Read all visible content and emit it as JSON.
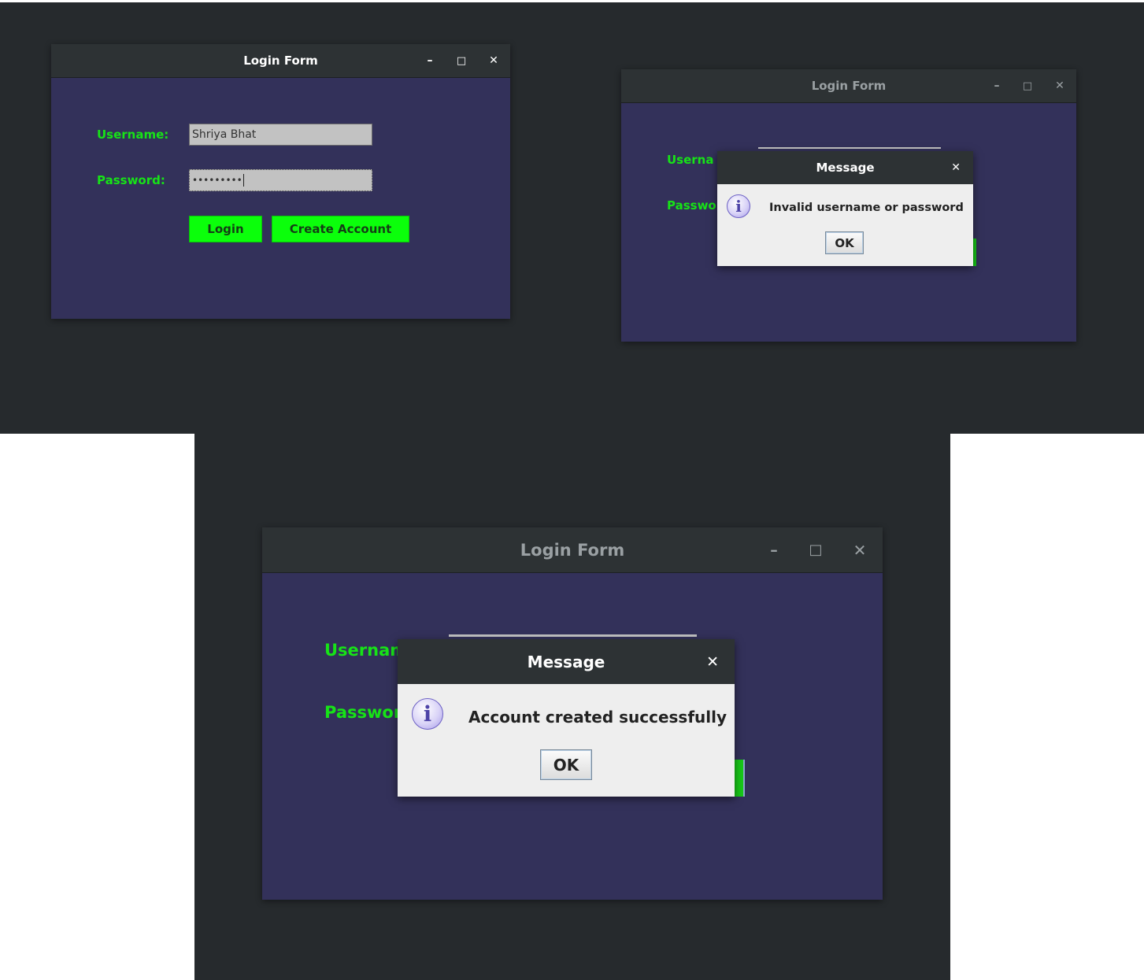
{
  "window_title": "Login Form",
  "window_controls": {
    "minimize": "–",
    "maximize": "□",
    "close": "✕"
  },
  "form": {
    "username_label": "Username:",
    "password_label": "Password:",
    "username_value": "Shriya Bhat",
    "password_value": "•••••••••",
    "login_label": "Login",
    "create_account_label": "Create Account"
  },
  "truncated_labels": {
    "panel2_username": "Userna",
    "panel2_password": "Passwo",
    "panel3_username": "Usernam",
    "panel3_password": "Passwor"
  },
  "dialog_error": {
    "title": "Message",
    "close": "✕",
    "message": "Invalid username or password",
    "ok_label": "OK",
    "icon": "info-icon"
  },
  "dialog_success": {
    "title": "Message",
    "close": "✕",
    "message": "Account created successfully",
    "ok_label": "OK",
    "icon": "info-icon"
  },
  "colors": {
    "desktop": "#262a2d",
    "window_body": "#33315a",
    "titlebar": "#2d3234",
    "label_green": "#17e317",
    "button_green": "#0bff0b",
    "field_gray": "#c2c2c2",
    "dialog_bg": "#eeeeee"
  }
}
